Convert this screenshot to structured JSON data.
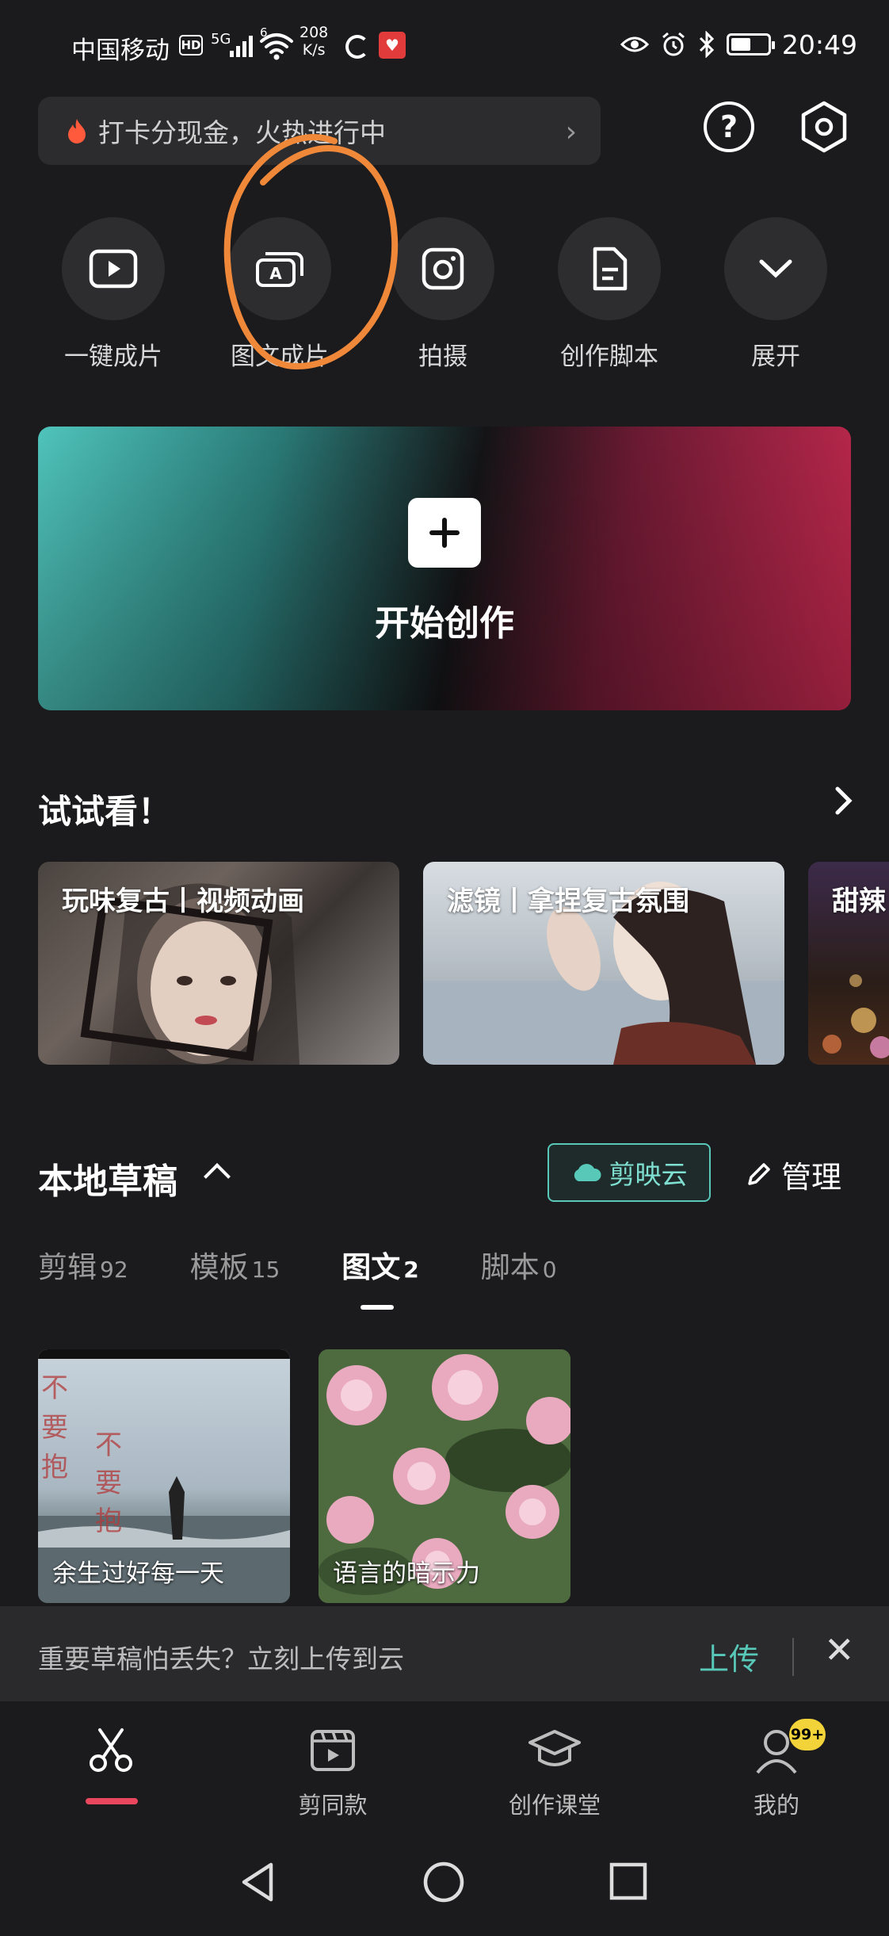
{
  "status_bar": {
    "carrier": "中国移动",
    "hd": "HD",
    "network": "5G",
    "wifi_num": "6",
    "speed_value": "208",
    "speed_unit": "K/s",
    "time": "20:49",
    "battery_level": 0.55
  },
  "promo": {
    "text": "打卡分现金，火热进行中"
  },
  "top_icons": {
    "help": "?",
    "settings": "settings"
  },
  "quick_actions": [
    {
      "label": "一键成片",
      "icon": "play-icon"
    },
    {
      "label": "图文成片",
      "icon": "text-image-icon"
    },
    {
      "label": "拍摄",
      "icon": "camera-icon"
    },
    {
      "label": "创作脚本",
      "icon": "script-icon"
    },
    {
      "label": "展开",
      "icon": "chevron-down-icon"
    }
  ],
  "banner": {
    "label": "开始创作"
  },
  "try_section": {
    "title": "试试看！",
    "cards": [
      {
        "title": "玩味复古丨视频动画"
      },
      {
        "title": "滤镜丨拿捏复古氛围"
      },
      {
        "title": "甜辣"
      }
    ]
  },
  "drafts": {
    "title": "本地草稿",
    "cloud_button": "剪映云",
    "manage_button": "管理",
    "tabs": [
      {
        "label": "剪辑",
        "count": "92"
      },
      {
        "label": "模板",
        "count": "15"
      },
      {
        "label": "图文",
        "count": "2"
      },
      {
        "label": "脚本",
        "count": "0"
      }
    ],
    "active_tab": 2,
    "items": [
      {
        "label": "余生过好每一天"
      },
      {
        "label": "语言的暗示力"
      }
    ]
  },
  "upload_bar": {
    "text": "重要草稿怕丢失？立刻上传到云",
    "action": "上传"
  },
  "bottom_nav": {
    "items": [
      {
        "label": ""
      },
      {
        "label": "剪同款"
      },
      {
        "label": "创作课堂"
      },
      {
        "label": "我的"
      }
    ],
    "badge": "99+"
  },
  "colors": {
    "accent": "#58c8b8",
    "active_underline": "#e8475d",
    "badge": "#f3d33a",
    "background": "#1b1b1d"
  }
}
